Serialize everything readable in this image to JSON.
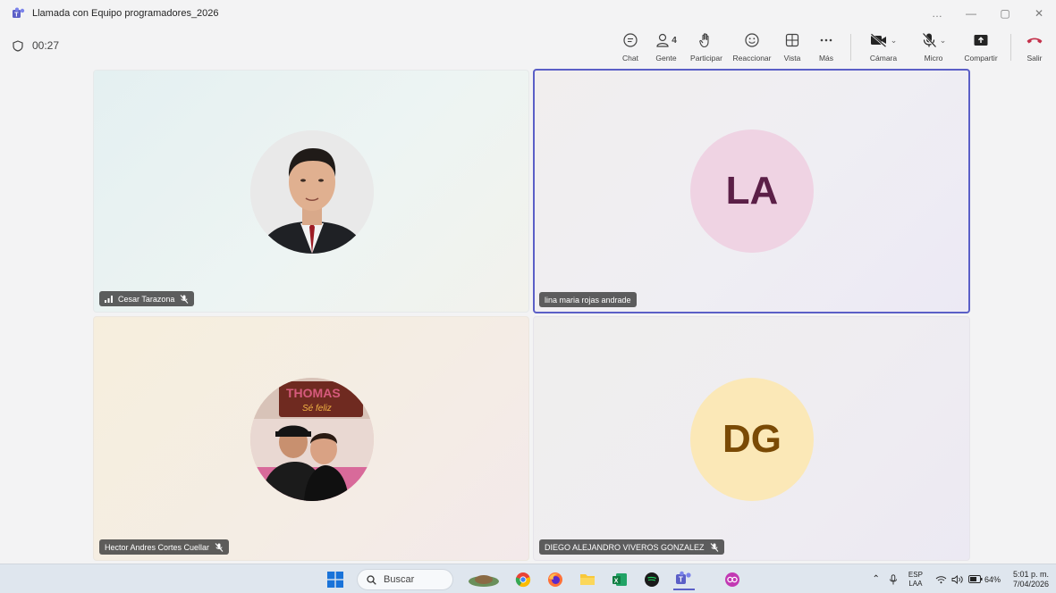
{
  "window": {
    "title": "Llamada con Equipo programadores_2026",
    "controls": [
      "…",
      "—",
      "▢",
      "✕"
    ]
  },
  "call": {
    "timer": "00:27"
  },
  "toolbar": {
    "chat_label": "Chat",
    "people_label": "Gente",
    "people_count": "4",
    "raise_hand_label": "Participar",
    "react_label": "Reaccionar",
    "view_label": "Vista",
    "more_label": "Más",
    "camera_label": "Cámara",
    "mic_label": "Micro",
    "share_label": "Compartir",
    "leave_label": "Salir"
  },
  "participants": [
    {
      "name": "Cesar Tarazona",
      "avatar": "photo",
      "muted": true,
      "signal": true
    },
    {
      "name": "lina maria rojas andrade",
      "initials": "LA",
      "muted": false,
      "active_speaker": true,
      "avatar_color": "#efd3e3",
      "initials_color": "#5b1f47"
    },
    {
      "name": "Hector Andres Cortes Cuellar",
      "avatar": "photo",
      "muted": true
    },
    {
      "name": "DIEGO ALEJANDRO VIVEROS GONZALEZ",
      "initials": "DG",
      "muted": true,
      "avatar_color": "#fbe8b7",
      "initials_color": "#7a4a05"
    }
  ],
  "taskbar": {
    "search_placeholder": "Buscar",
    "language": "ESP",
    "language_sub": "LAA",
    "battery": "64%",
    "time": "5:01 p. m.",
    "date": "7/04/2026"
  },
  "colors": {
    "accent": "#5b5fc7",
    "leave_red": "#c4314b"
  }
}
